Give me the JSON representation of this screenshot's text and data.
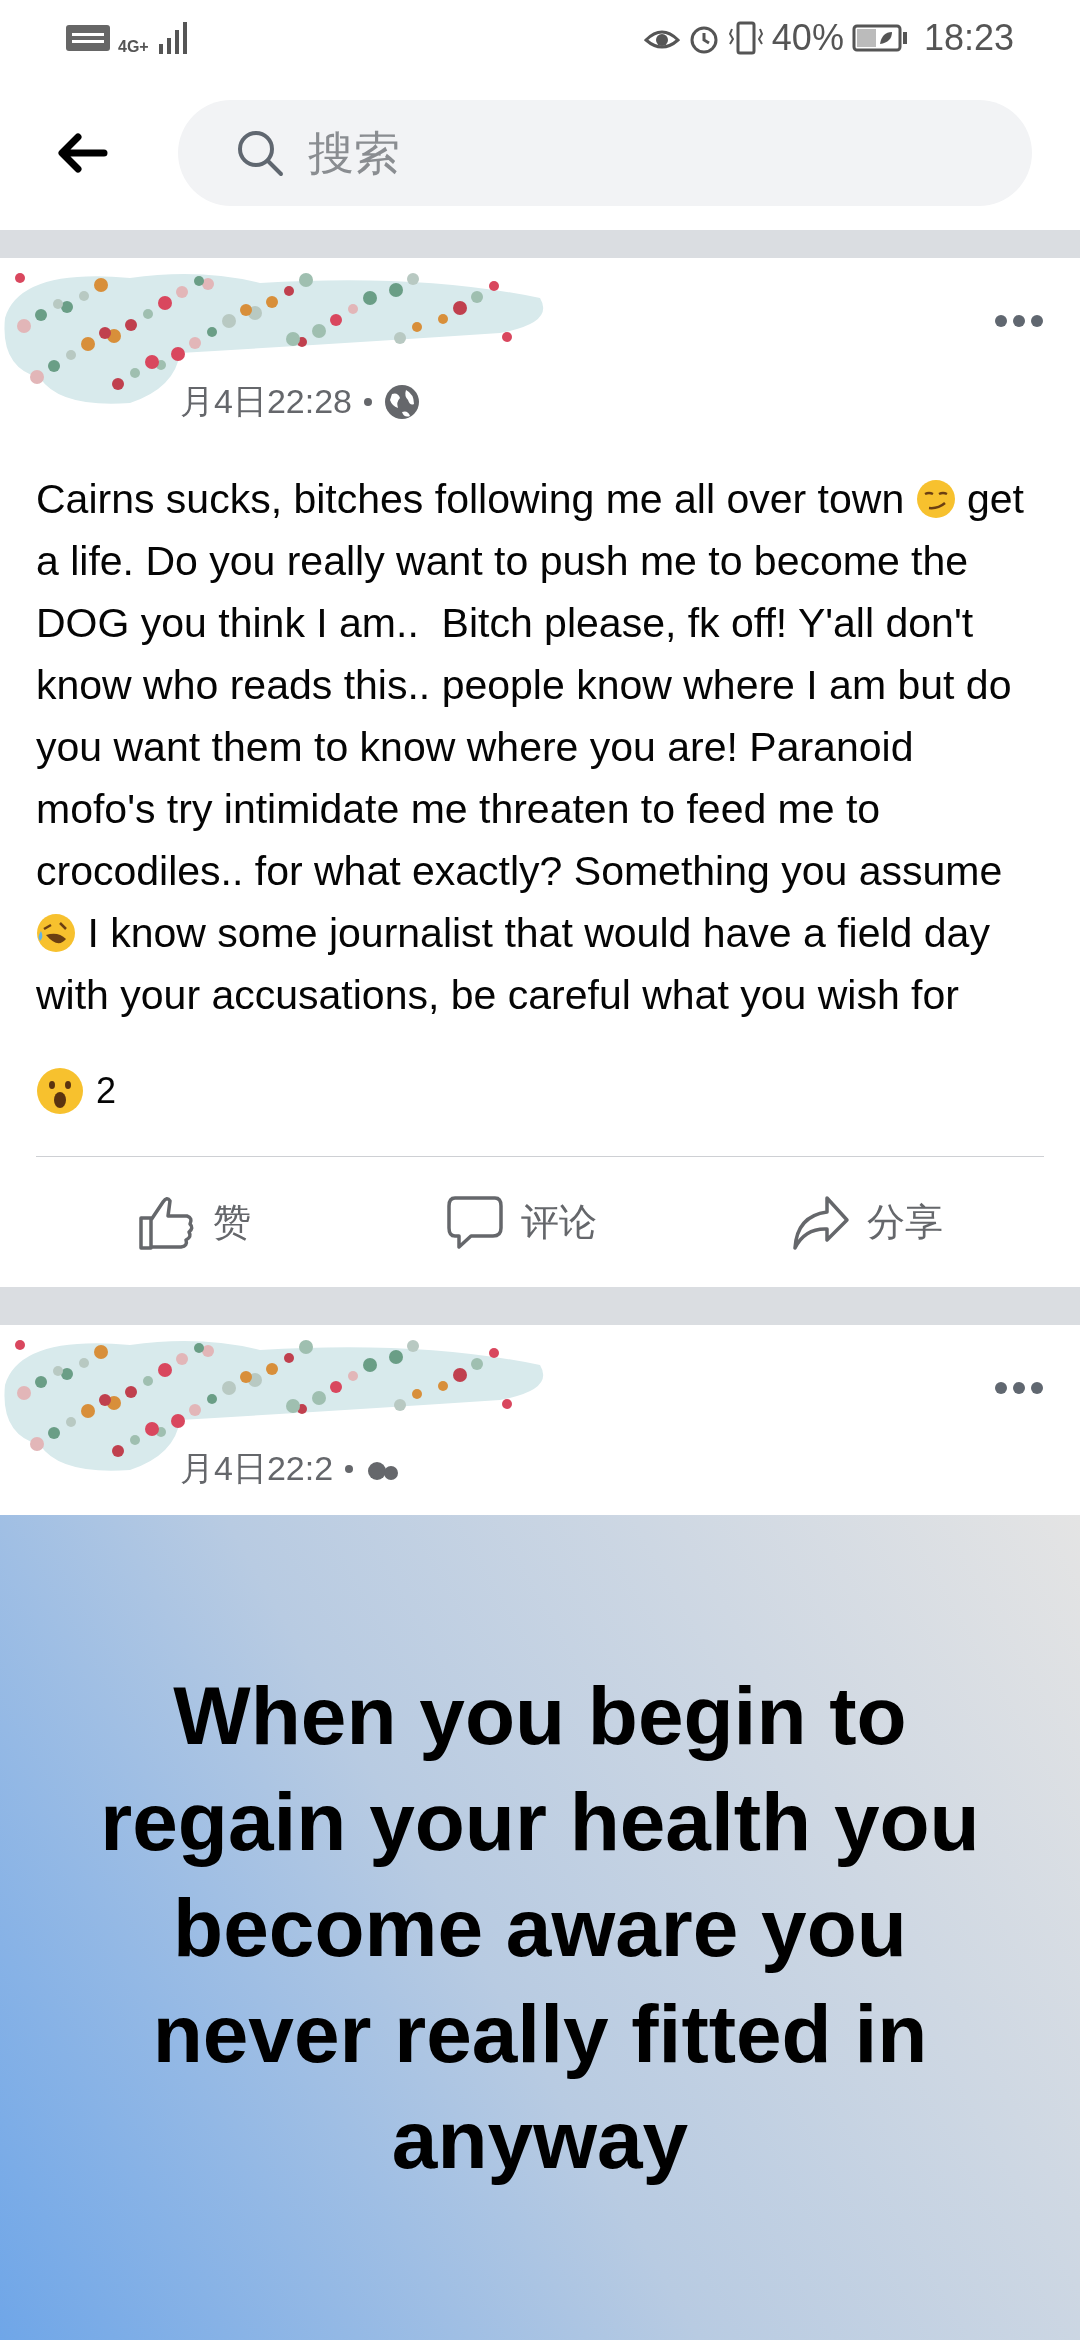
{
  "status_bar": {
    "network": "4G+",
    "battery": "40%",
    "time": "18:23"
  },
  "search": {
    "placeholder": "搜索"
  },
  "posts": [
    {
      "time": "月4日22:28",
      "body": [
        {
          "kind": "text",
          "text": "Cairns sucks, bitches following me all over town "
        },
        {
          "kind": "smirk"
        },
        {
          "kind": "text",
          "text": " get a life. Do you really want to push me to become the DOG you think I am..  Bitch please, fk off! Y'all don't know who reads this.. people know where I am but do you want them to know where you are! Paranoid mofo's try intimidate me threaten to feed me to crocodiles.. for what exactly? Something you assume "
        },
        {
          "kind": "laugh"
        },
        {
          "kind": "text",
          "text": " I know some journalist that would have a field day with your accusations, be careful what you wish for"
        }
      ],
      "reactions": "2",
      "actions": [
        {
          "kind": "like",
          "label": "赞"
        },
        {
          "kind": "comment",
          "label": "评论"
        },
        {
          "kind": "share",
          "label": "分享"
        }
      ]
    },
    {
      "time": "月4日22:2",
      "image_text": "When you begin to regain your health you become aware you never really fitted in anyway"
    }
  ]
}
